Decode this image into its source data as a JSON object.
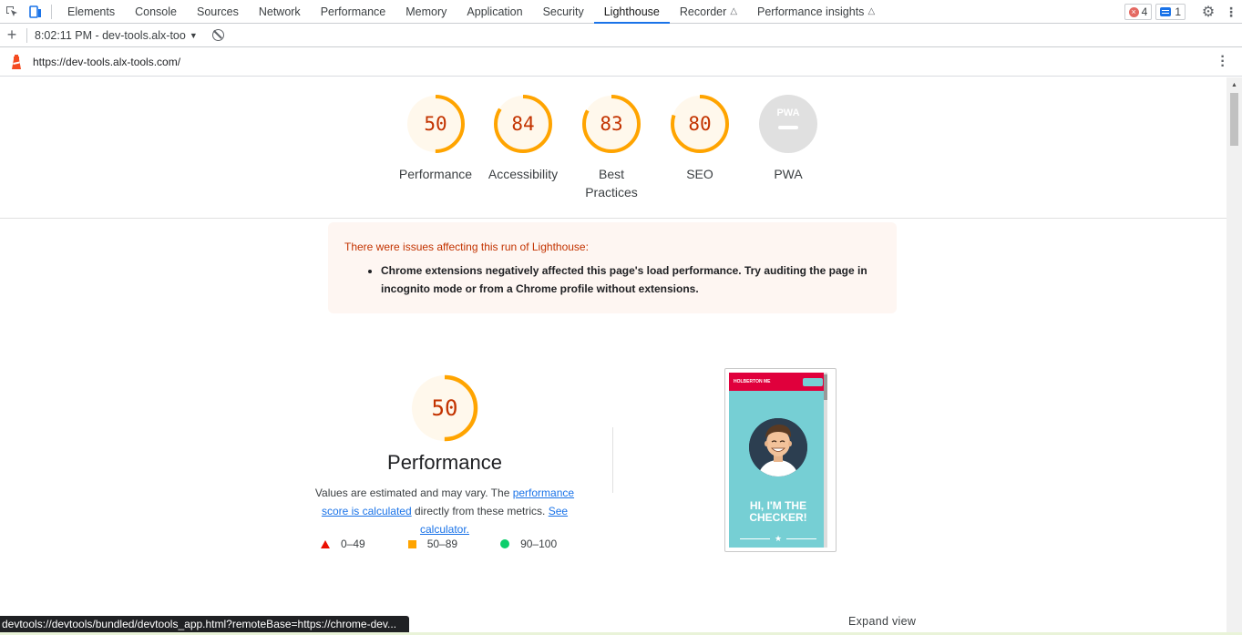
{
  "devtools": {
    "tabs": [
      {
        "label": "Elements"
      },
      {
        "label": "Console"
      },
      {
        "label": "Sources"
      },
      {
        "label": "Network"
      },
      {
        "label": "Performance"
      },
      {
        "label": "Memory"
      },
      {
        "label": "Application"
      },
      {
        "label": "Security"
      },
      {
        "label": "Lighthouse",
        "active": true
      },
      {
        "label": "Recorder",
        "experimental": true
      },
      {
        "label": "Performance insights",
        "experimental": true
      }
    ],
    "error_count": "4",
    "message_count": "1"
  },
  "toolbar": {
    "report_label": "8:02:11 PM - dev-tools.alx-too"
  },
  "urlbar": {
    "url": "https://dev-tools.alx-tools.com/"
  },
  "scores": [
    {
      "value": 50,
      "label": "Performance",
      "color": "#ffa400"
    },
    {
      "value": 84,
      "label": "Accessibility",
      "color": "#ffa400"
    },
    {
      "value": 83,
      "label": "Best Practices",
      "color": "#ffa400"
    },
    {
      "value": 80,
      "label": "SEO",
      "color": "#ffa400"
    },
    {
      "value": null,
      "label": "PWA",
      "badge": "PWA"
    }
  ],
  "warning": {
    "title": "There were issues affecting this run of Lighthouse:",
    "items": [
      "Chrome extensions negatively affected this page's load performance. Try auditing the page in incognito mode or from a Chrome profile without extensions."
    ]
  },
  "performance": {
    "score": 50,
    "title": "Performance",
    "desc_prefix": "Values are estimated and may vary. The ",
    "link_score": "performance score is calculated",
    "desc_middle": " directly from these metrics. ",
    "link_calculator": "See calculator.",
    "legend": [
      {
        "range": "0–49",
        "color": "#eb0f00",
        "shape": "triangle"
      },
      {
        "range": "50–89",
        "color": "#ffa400",
        "shape": "square"
      },
      {
        "range": "90–100",
        "color": "#0cce6b",
        "shape": "circle"
      }
    ]
  },
  "screenshot": {
    "brand": "HOLBERTON ME",
    "headline_line1": "HI, I'M THE",
    "headline_line2": "CHECKER!"
  },
  "expand_view": "Expand view",
  "status_url": "devtools://devtools/bundled/devtools_app.html?remoteBase=https://chrome-dev..."
}
